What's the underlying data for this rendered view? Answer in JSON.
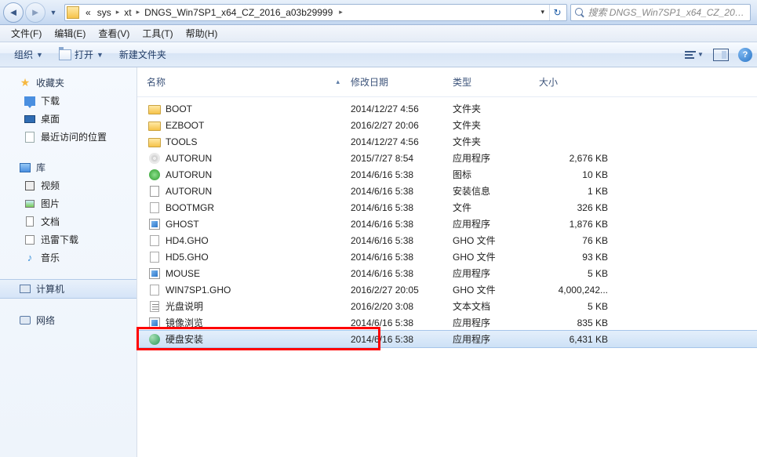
{
  "nav": {
    "crumbs": [
      "sys",
      "xt",
      "DNGS_Win7SP1_x64_CZ_2016_a03b29999"
    ],
    "search_placeholder": "搜索 DNGS_Win7SP1_x64_CZ_2016..."
  },
  "menu": {
    "file": "文件(F)",
    "edit": "编辑(E)",
    "view": "查看(V)",
    "tools": "工具(T)",
    "help": "帮助(H)"
  },
  "toolbar": {
    "organize": "组织",
    "open": "打开",
    "newfolder": "新建文件夹"
  },
  "sidebar": {
    "favorites": {
      "label": "收藏夹",
      "items": [
        "下载",
        "桌面",
        "最近访问的位置"
      ]
    },
    "libraries": {
      "label": "库",
      "items": [
        "视频",
        "图片",
        "文档",
        "迅雷下载",
        "音乐"
      ]
    },
    "computer": {
      "label": "计算机"
    },
    "network": {
      "label": "网络"
    }
  },
  "columns": {
    "name": "名称",
    "date": "修改日期",
    "type": "类型",
    "size": "大小"
  },
  "files": [
    {
      "icon": "folder",
      "name": "BOOT",
      "date": "2014/12/27 4:56",
      "type": "文件夹",
      "size": ""
    },
    {
      "icon": "folder",
      "name": "EZBOOT",
      "date": "2016/2/27 20:06",
      "type": "文件夹",
      "size": ""
    },
    {
      "icon": "folder",
      "name": "TOOLS",
      "date": "2014/12/27 4:56",
      "type": "文件夹",
      "size": ""
    },
    {
      "icon": "disc",
      "name": "AUTORUN",
      "date": "2015/7/27 8:54",
      "type": "应用程序",
      "size": "2,676 KB"
    },
    {
      "icon": "ico",
      "name": "AUTORUN",
      "date": "2014/6/16 5:38",
      "type": "图标",
      "size": "10 KB"
    },
    {
      "icon": "inf",
      "name": "AUTORUN",
      "date": "2014/6/16 5:38",
      "type": "安装信息",
      "size": "1 KB"
    },
    {
      "icon": "file",
      "name": "BOOTMGR",
      "date": "2014/6/16 5:38",
      "type": "文件",
      "size": "326 KB"
    },
    {
      "icon": "app",
      "name": "GHOST",
      "date": "2014/6/16 5:38",
      "type": "应用程序",
      "size": "1,876 KB"
    },
    {
      "icon": "gho",
      "name": "HD4.GHO",
      "date": "2014/6/16 5:38",
      "type": "GHO 文件",
      "size": "76 KB"
    },
    {
      "icon": "gho",
      "name": "HD5.GHO",
      "date": "2014/6/16 5:38",
      "type": "GHO 文件",
      "size": "93 KB"
    },
    {
      "icon": "app",
      "name": "MOUSE",
      "date": "2014/6/16 5:38",
      "type": "应用程序",
      "size": "5 KB"
    },
    {
      "icon": "gho",
      "name": "WIN7SP1.GHO",
      "date": "2016/2/27 20:05",
      "type": "GHO 文件",
      "size": "4,000,242..."
    },
    {
      "icon": "txt",
      "name": "光盘说明",
      "date": "2016/2/20 3:08",
      "type": "文本文档",
      "size": "5 KB"
    },
    {
      "icon": "app",
      "name": "镜像浏览",
      "date": "2014/6/16 5:38",
      "type": "应用程序",
      "size": "835 KB"
    },
    {
      "icon": "disk",
      "name": "硬盘安装",
      "date": "2014/6/16 5:38",
      "type": "应用程序",
      "size": "6,431 KB",
      "selected": true
    }
  ]
}
